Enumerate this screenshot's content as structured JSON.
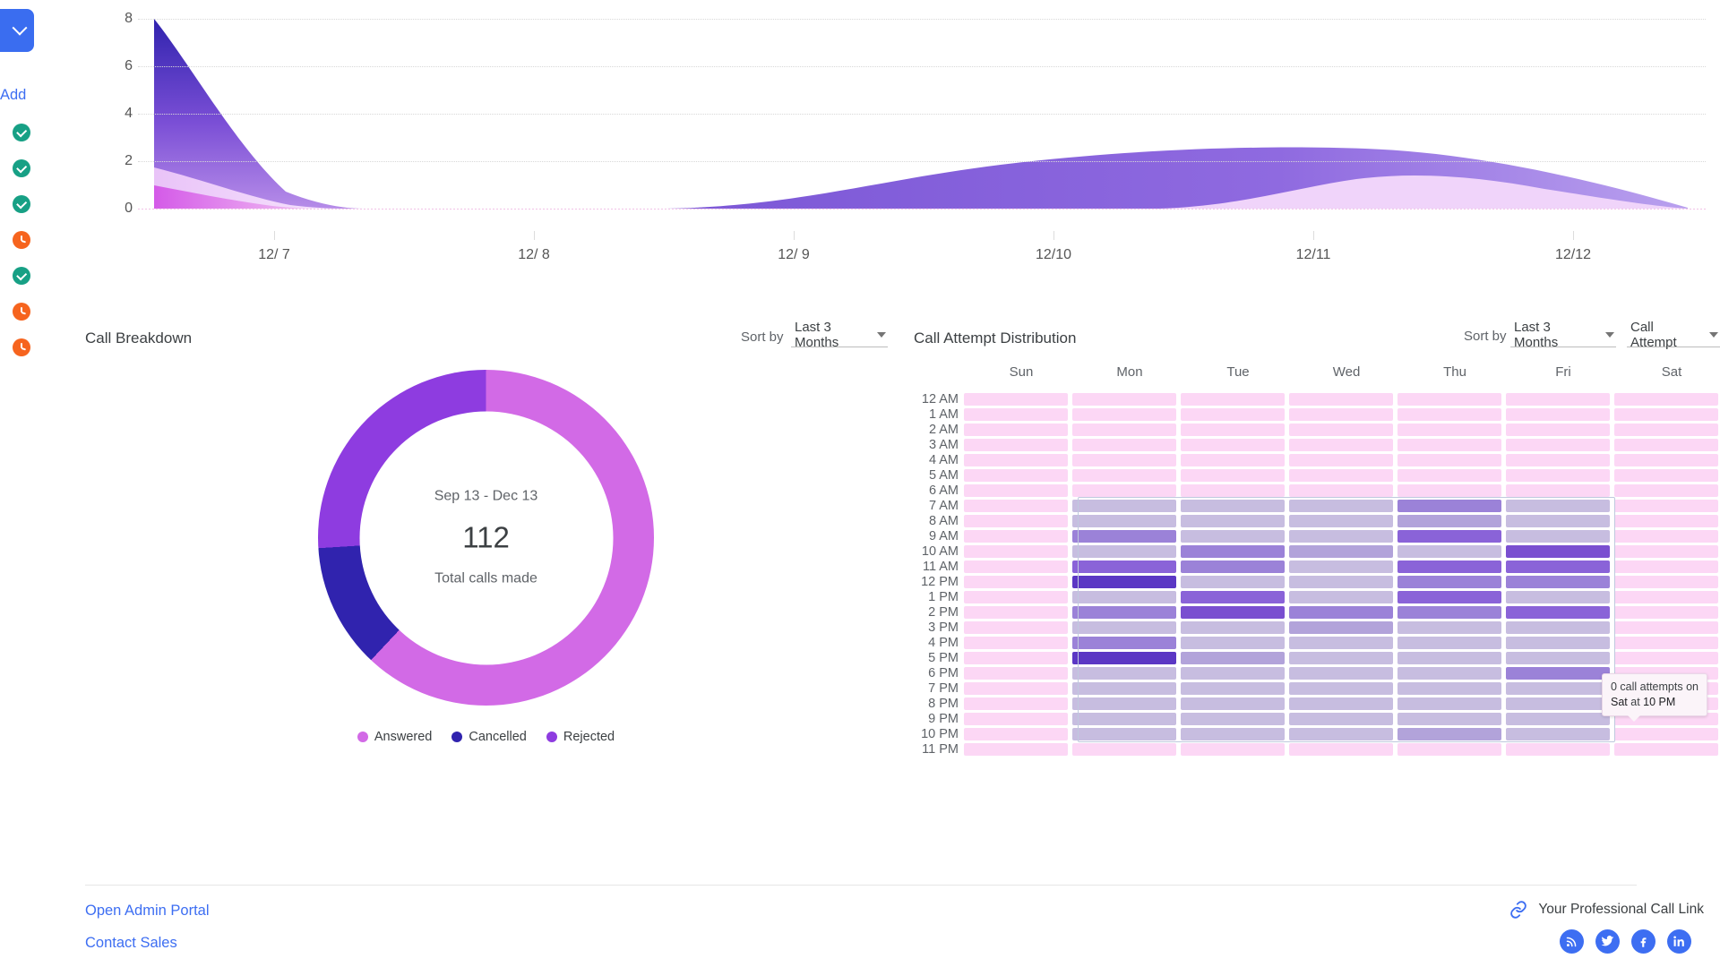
{
  "rail": {
    "toggle_icon": "chevron-down-icon",
    "add_label": "Add",
    "status_icons": [
      {
        "name": "check-circle-icon",
        "type": "ok"
      },
      {
        "name": "check-circle-icon",
        "type": "ok"
      },
      {
        "name": "check-circle-icon",
        "type": "ok"
      },
      {
        "name": "clock-icon",
        "type": "wait"
      },
      {
        "name": "check-circle-icon",
        "type": "ok"
      },
      {
        "name": "clock-icon",
        "type": "wait"
      },
      {
        "name": "clock-icon",
        "type": "wait"
      }
    ]
  },
  "call_breakdown": {
    "title": "Call Breakdown",
    "sort_label": "Sort by",
    "sort_value": "Last 3 Months",
    "center_range": "Sep 13 - Dec 13",
    "center_number": "112",
    "center_caption": "Total calls made",
    "legend": [
      {
        "label": "Answered",
        "color": "#d26ae6"
      },
      {
        "label": "Cancelled",
        "color": "#3023ae"
      },
      {
        "label": "Rejected",
        "color": "#8e3ce0"
      }
    ]
  },
  "call_attempt_distribution": {
    "title": "Call Attempt Distribution",
    "sort_label": "Sort by",
    "sort_value": "Last 3 Months",
    "metric_value": "Call Attempt",
    "tooltip": {
      "line1": "0 call attempts on",
      "line2_day": "Sat",
      "line2_mid": " at ",
      "line2_time": "10 PM"
    }
  },
  "footer": {
    "admin_portal": "Open Admin Portal",
    "contact_sales": "Contact Sales",
    "call_link_text": "Your Professional Call Link",
    "call_link_icon": "link-icon",
    "socials": [
      {
        "name": "rss-icon"
      },
      {
        "name": "twitter-icon"
      },
      {
        "name": "facebook-icon"
      },
      {
        "name": "linkedin-icon"
      }
    ]
  },
  "chart_data": [
    {
      "type": "area",
      "title": "",
      "xlabel": "",
      "ylabel": "",
      "ylim": [
        0,
        8
      ],
      "yticks": [
        0,
        2,
        4,
        6,
        8
      ],
      "grid": true,
      "legend_position": "none",
      "x": [
        "12/ 7",
        "12/ 8",
        "12/ 9",
        "12/10",
        "12/11",
        "12/12"
      ],
      "x_tick_labels": [
        "12/ 7",
        "12/ 8",
        "12/ 9",
        "12/10",
        "12/11",
        "12/12"
      ],
      "series": [
        {
          "name": "Rejected",
          "color": "#8e3ce0",
          "values": [
            8.0,
            0.0,
            0.0,
            1.4,
            2.3,
            2.0
          ]
        },
        {
          "name": "Cancelled",
          "color": "#e8c6f7",
          "values": [
            1.7,
            0.0,
            0.0,
            0.0,
            0.0,
            0.0
          ]
        },
        {
          "name": "Answered",
          "color": "#d26ae6",
          "values": [
            1.0,
            0.0,
            0.0,
            0.0,
            1.3,
            1.2
          ]
        }
      ]
    },
    {
      "type": "pie",
      "title": "Call Breakdown",
      "labels": [
        "Answered",
        "Cancelled",
        "Rejected"
      ],
      "values": [
        62,
        12,
        26
      ],
      "colors": [
        "#d26ae6",
        "#3023ae",
        "#8e3ce0"
      ],
      "total": 112,
      "total_caption": "Total calls made",
      "range": "Sep 13 - Dec 13",
      "legend_position": "bottom"
    },
    {
      "type": "heatmap",
      "title": "Call Attempt Distribution",
      "xlabel": "",
      "ylabel": "",
      "x": [
        "Sun",
        "Mon",
        "Tue",
        "Wed",
        "Thu",
        "Fri",
        "Sat"
      ],
      "y": [
        "12 AM",
        "1 AM",
        "2 AM",
        "3 AM",
        "4 AM",
        "5 AM",
        "6 AM",
        "7 AM",
        "8 AM",
        "9 AM",
        "10 AM",
        "11 AM",
        "12 PM",
        "1 PM",
        "2 PM",
        "3 PM",
        "4 PM",
        "5 PM",
        "6 PM",
        "7 PM",
        "8 PM",
        "9 PM",
        "10 PM",
        "11 PM"
      ],
      "empty_color": "#fcd7f5",
      "colorscale": [
        "#c7bde0",
        "#b2a3da",
        "#9b82d8",
        "#8a63d8",
        "#7a4fd0",
        "#5b37c4",
        "#3023ae"
      ],
      "values": [
        [
          0,
          0,
          0,
          0,
          0,
          0,
          0
        ],
        [
          0,
          0,
          0,
          0,
          0,
          0,
          0
        ],
        [
          0,
          0,
          0,
          0,
          0,
          0,
          0
        ],
        [
          0,
          0,
          0,
          0,
          0,
          0,
          0
        ],
        [
          0,
          0,
          0,
          0,
          0,
          0,
          0
        ],
        [
          0,
          0,
          0,
          0,
          0,
          0,
          0
        ],
        [
          0,
          0,
          0,
          0,
          0,
          0,
          0
        ],
        [
          0,
          1,
          1,
          1,
          3,
          1,
          0
        ],
        [
          0,
          1,
          1,
          1,
          2,
          1,
          0
        ],
        [
          0,
          3,
          1,
          1,
          4,
          1,
          0
        ],
        [
          0,
          1,
          3,
          2,
          1,
          5,
          0
        ],
        [
          0,
          4,
          3,
          1,
          4,
          4,
          0
        ],
        [
          0,
          6,
          1,
          1,
          3,
          3,
          0
        ],
        [
          0,
          1,
          4,
          1,
          4,
          1,
          0
        ],
        [
          0,
          3,
          5,
          3,
          3,
          4,
          0
        ],
        [
          0,
          1,
          1,
          2,
          1,
          1,
          0
        ],
        [
          0,
          3,
          1,
          1,
          1,
          1,
          0
        ],
        [
          0,
          6,
          2,
          1,
          1,
          1,
          0
        ],
        [
          0,
          1,
          1,
          1,
          1,
          3,
          0
        ],
        [
          0,
          1,
          1,
          1,
          1,
          1,
          0
        ],
        [
          0,
          1,
          1,
          1,
          1,
          1,
          0
        ],
        [
          0,
          1,
          1,
          1,
          1,
          1,
          0
        ],
        [
          0,
          1,
          1,
          1,
          2,
          1,
          0
        ],
        [
          0,
          0,
          0,
          0,
          0,
          0,
          0
        ]
      ]
    }
  ]
}
